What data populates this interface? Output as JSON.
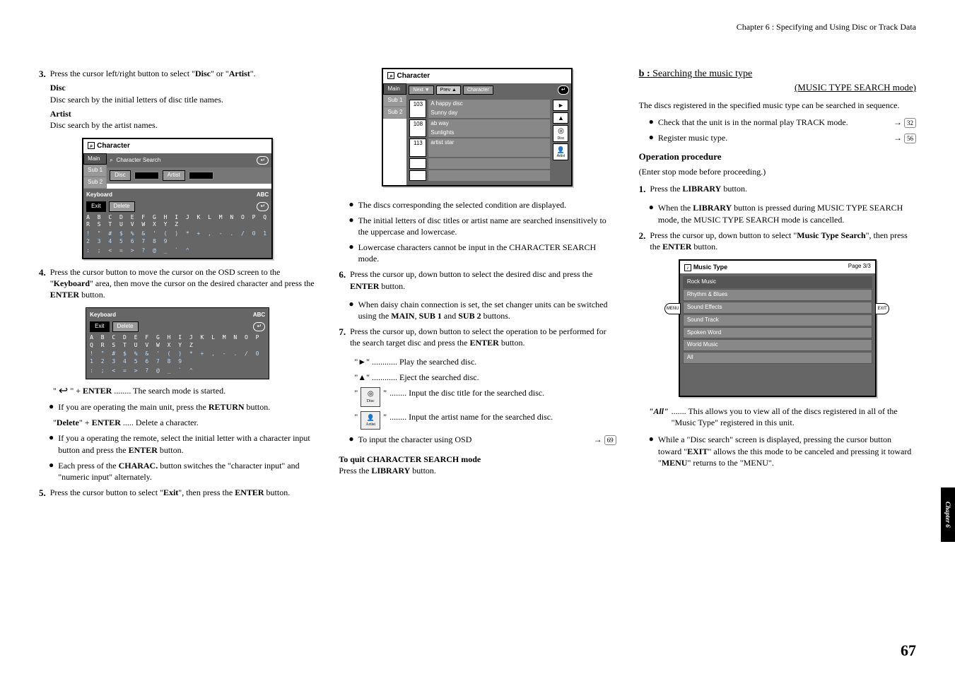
{
  "header": "Chapter 6 : Specifying and Using Disc or Track Data",
  "col1": {
    "step3_num": "3.",
    "step3": "Press the cursor left/right button to select \"",
    "step3_disc": "Disc",
    "step3_or": "\" or \"",
    "step3_artist": "Artist",
    "step3_end": "\".",
    "disc_h": "Disc",
    "disc_t": "Disc search by the initial letters of disc title names.",
    "artist_h": "Artist",
    "artist_t": "Disc search by the artist names.",
    "panel1": {
      "title": "Character",
      "tab_main": "Main",
      "tab_sub1": "Sub 1",
      "tab_sub2": "Sub 2",
      "search_lbl": "Character Search",
      "disc_lbl": "Disc",
      "artist_lbl": "Artist",
      "kb_lbl": "Keyboard",
      "abc_lbl": "ABC",
      "exit_lbl": "Exit",
      "del_lbl": "Delete",
      "row1": "A B C D E F G H I J K L M N O P Q R S T U V W X Y Z",
      "row2": "! \" # $ % & ' ( ) * + , - . / 0 1 2 3 4 5 6 7 8 9",
      "row3": ": ; < = > ? @ _ ` ^"
    },
    "step4_num": "4.",
    "step4": "Press the cursor button to move the cursor on the OSD screen to the \"",
    "step4_kb": "Keyboard",
    "step4_mid": "\" area, then move the cursor on the desired character and press the ",
    "step4_enter": "ENTER",
    "step4_end": " button.",
    "kb2": {
      "kb_lbl": "Keyboard",
      "abc_lbl": "ABC",
      "exit_lbl": "Exit",
      "del_lbl": "Delete",
      "row1": "A B C D E F G H I J K L M N O P Q R S T U V W X Y Z",
      "row2": "! \" # $ % & ' ( ) * + , - . / 0 1 2 3 4 5 6 7 8 9",
      "row3": ": ; < = > ? @ _ ` ^"
    },
    "enter_line_a": "\" ",
    "enter_line_b": " \" + ",
    "enter_line_c": "ENTER",
    "enter_line_d": " ........ The search mode is started.",
    "b1": "If you are operating the main unit, press the ",
    "b1b": "RETURN",
    "b1c": " button.",
    "del_line_a": "\"",
    "del_line_b": "Delete",
    "del_line_c": "\" + ",
    "del_line_d": "ENTER",
    "del_line_e": " ..... Delete a character.",
    "b2a": "If you a operating the remote, select the initial letter with a character input button and press the ",
    "b2b": "ENTER",
    "b2c": " button.",
    "b3a": "Each press of the ",
    "b3b": "CHARAC.",
    "b3c": " button switches the \"character input\" and \"numeric input\" alternately.",
    "step5_num": "5.",
    "step5a": "Press the cursor button to select \"",
    "step5b": "Exit",
    "step5c": "\", then press the ",
    "step5d": "ENTER",
    "step5e": " button."
  },
  "col2": {
    "panel": {
      "title": "Character",
      "tab_main": "Main",
      "tab_sub1": "Sub 1",
      "tab_sub2": "Sub 2",
      "next": "Next ▼",
      "prev": "Prev ▲",
      "chars": "Character",
      "r1n": "103",
      "r1a": "A happy disc",
      "r1b": "Sunny day",
      "r2n": "108",
      "r2a": "ab way",
      "r2b": "Sunlights",
      "r3n": "113",
      "r3a": "artist star",
      "disc_i": "Disc",
      "artist_i": "Artist"
    },
    "b1": "The discs corresponding the selected condition are displayed.",
    "b2": "The initial letters of disc titles or artist name are searched insensitively to the uppercase and lowercase.",
    "b3": "Lowercase characters cannot be input in the CHARACTER SEARCH mode.",
    "step6_num": "6.",
    "step6a": "Press the cursor up, down button to select the desired disc and press the ",
    "step6b": "ENTER",
    "step6c": " button.",
    "b4a": "When daisy chain connection is set, the set changer units can be switched using the ",
    "b4b": "MAIN",
    "b4c": ", ",
    "b4d": "SUB 1",
    "b4e": " and ",
    "b4f": "SUB 2",
    "b4g": " buttons.",
    "step7_num": "7.",
    "step7a": "Press the cursor up, down button to select the operation to be performed for the search target disc and press the ",
    "step7b": "ENTER",
    "step7c": " button.",
    "play_l": "\"►\" ............ Play the searched disc.",
    "eject_l": "\"▲\" ............ Eject the searched disc.",
    "disc_l": " ........ Input the disc title for the searched disc.",
    "artist_l": " ........ Input the artist name for the searched disc.",
    "osd_a": "To input the character using OSD",
    "osd_ref": "69",
    "quit_h": "To quit CHARACTER SEARCH mode",
    "quit_a": "Press the ",
    "quit_b": "LIBRARY",
    "quit_c": " button."
  },
  "col3": {
    "b_head": "b :",
    "b_title": " Searching the music type",
    "b_sub": "(MUSIC TYPE SEARCH mode)",
    "intro": "The discs registered in the specified music type can be searched in sequence.",
    "c1": "Check that the unit is in the normal play TRACK mode.",
    "c1ref": "32",
    "c2": "Register music type.",
    "c2ref": "56",
    "op_h": "Operation procedure",
    "op_t": "(Enter stop mode before proceeding.)",
    "s1_num": "1.",
    "s1a": "Press the ",
    "s1b": "LIBRARY",
    "s1c": " button.",
    "s1b1a": "When the ",
    "s1b1b": "LIBRARY",
    "s1b1c": " button is pressed during MUSIC TYPE SEARCH mode, the MUSIC TYPE SEARCH mode is cancelled.",
    "s2_num": "2.",
    "s2a": "Press the cursor up, down button to select \"",
    "s2b": "Music Type Search",
    "s2c": "\", then press the ",
    "s2d": "ENTER",
    "s2e": " button.",
    "mt": {
      "title": "Music Type",
      "page": "Page 3/3",
      "i1": "Rock Music",
      "i2": "Rhythm & Blues",
      "i3": "Sound Effects",
      "i4": "Sound Track",
      "i5": "Spoken Word",
      "i6": "World Music",
      "i7": "All",
      "menu": "MENU",
      "exit": "EXIT"
    },
    "all_h": "\"All\"",
    "all_t": " ....... This allows you to view all of the discs registered in all of the \"Music Type\" registered in this unit.",
    "last_a": "While a \"Disc search\" screen is displayed, pressing the cursor button toward \"",
    "last_b": "EXIT",
    "last_c": "\" allows the this mode to be canceled and pressing it toward \"",
    "last_d": "MENU",
    "last_e": "\" returns to the \"MENU\"."
  },
  "chapter_tab": "Chapter 6",
  "page_num": "67"
}
